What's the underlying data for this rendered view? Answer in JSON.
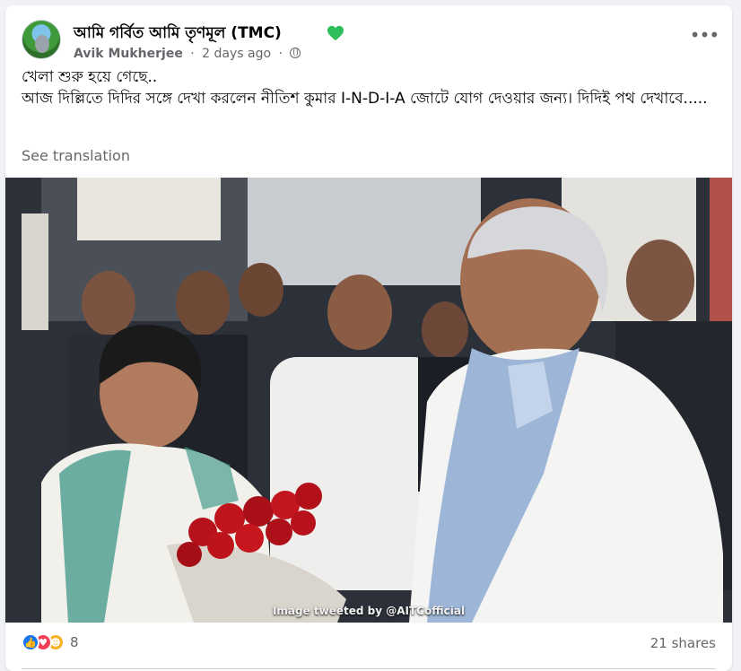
{
  "post": {
    "page_name": "আমি গর্বিত আমি তৃণমূল (TMC)",
    "author": "Avik Mukherjee",
    "time": "2 days ago",
    "separator": "·",
    "more_label": "•••",
    "text_line1": "খেলা শুরু হয়ে গেছে..",
    "text_line2": "আজ দিল্লিতে দিদির সঙ্গে দেখা করলেন নীতিশ কুমার I-N-D-I-A জোটে যোগ দেওয়ার জন্য। দিদিই পথ দেখাবে.....",
    "see_translation": "See translation",
    "image_credit": "Image tweeted by @AITCofficial"
  },
  "footer": {
    "reaction_count": "8",
    "shares": "21 shares",
    "reaction_icons": [
      "like-icon",
      "love-icon",
      "care-icon"
    ]
  },
  "colors": {
    "badge_heart": "#2fbf5a",
    "like": "#1877f2",
    "love": "#f33e58",
    "care": "#f7b125",
    "muted_text": "#65676b"
  }
}
